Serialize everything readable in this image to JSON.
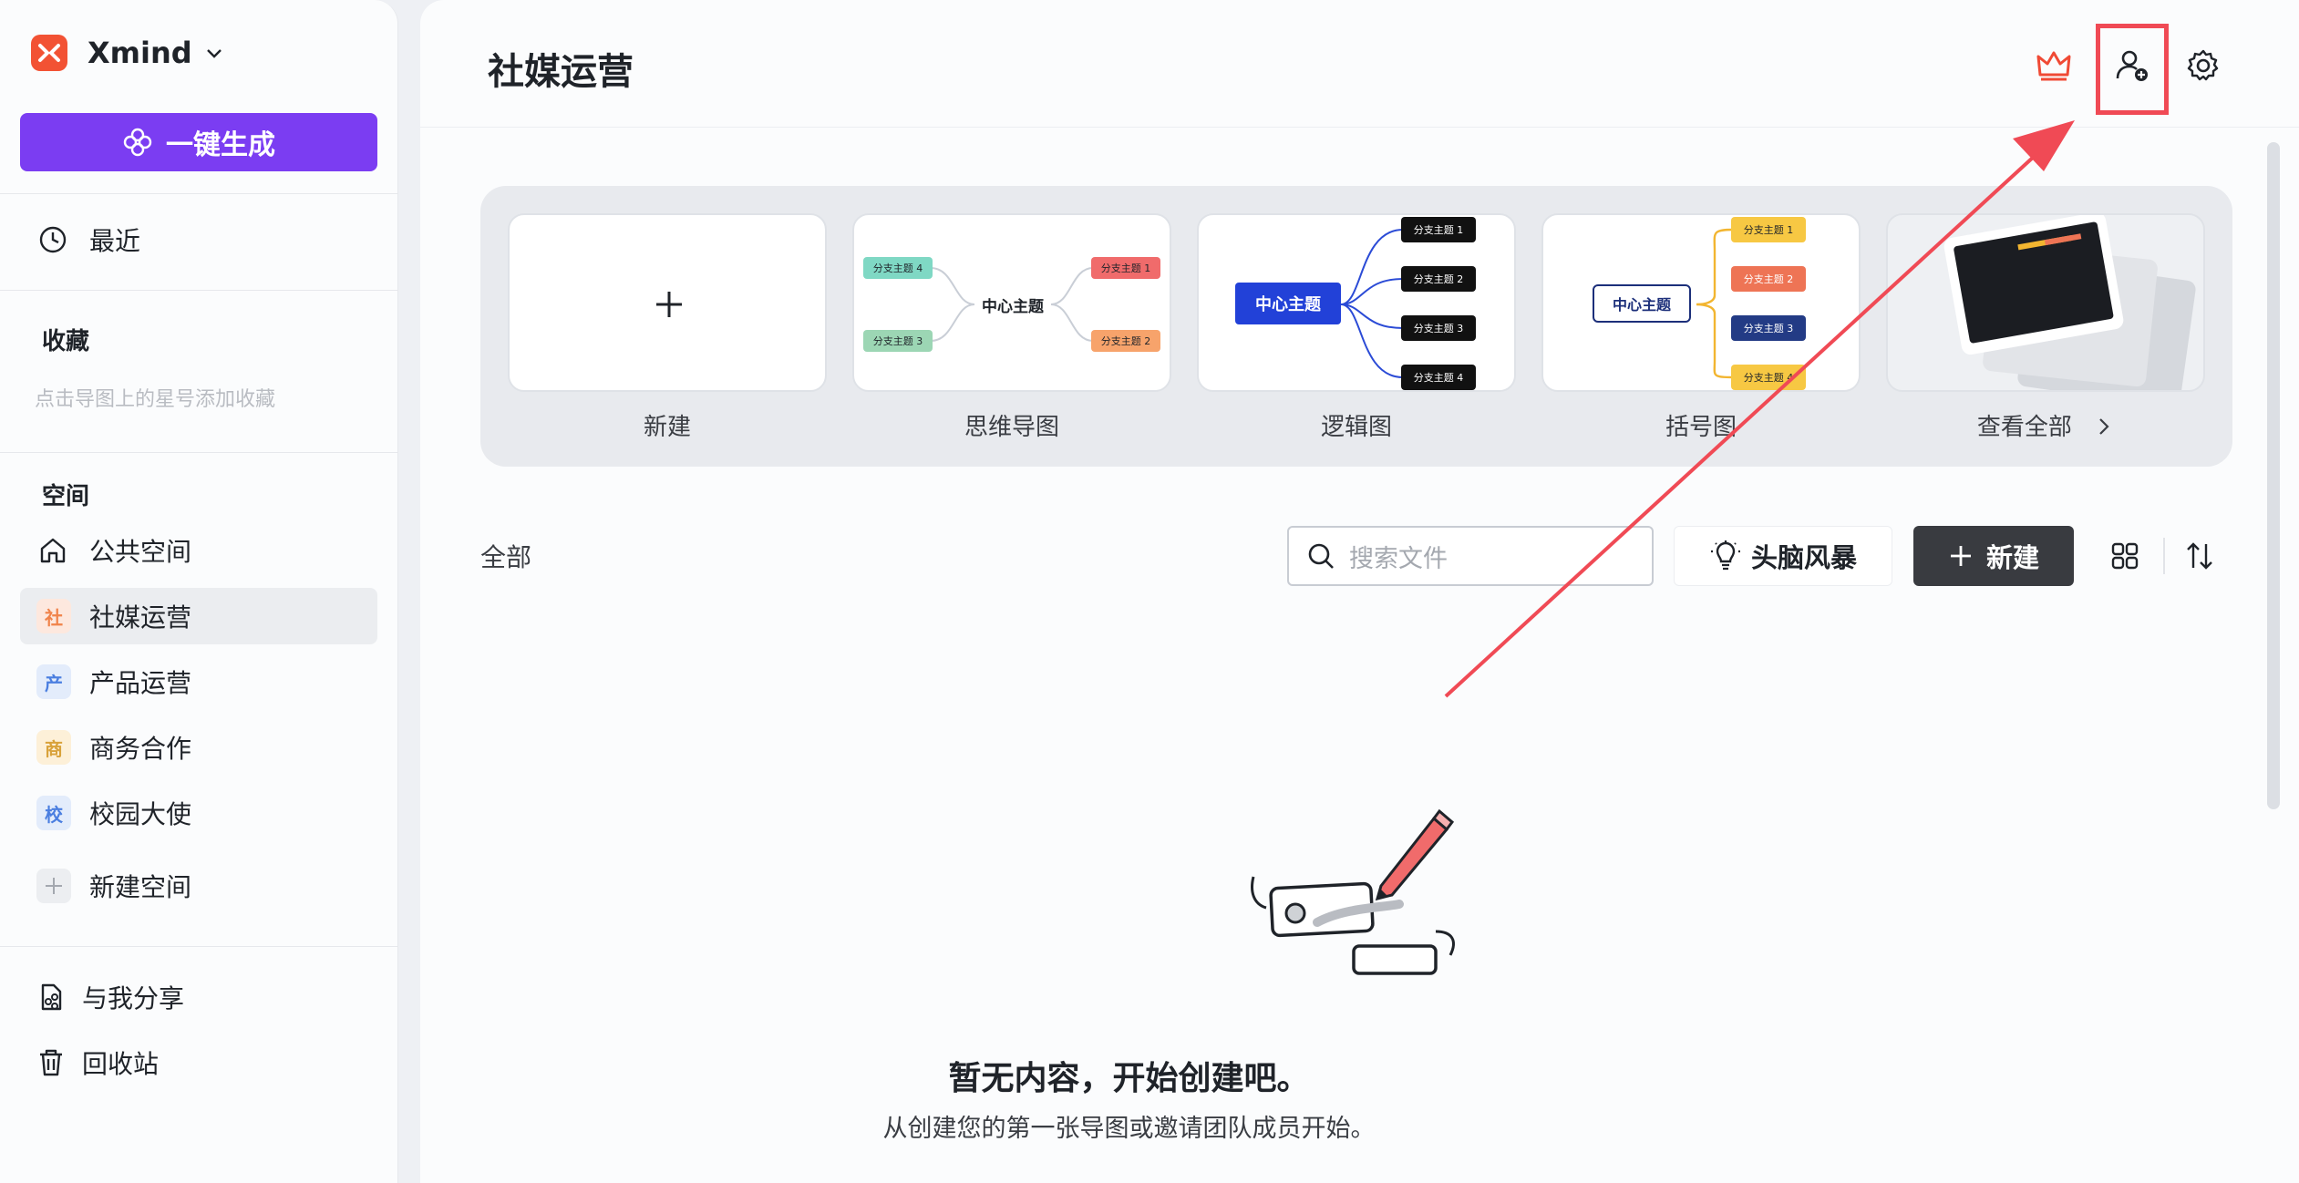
{
  "app": {
    "name": "Xmind"
  },
  "sidebar": {
    "ai_button": "一键生成",
    "recent": "最近",
    "favorites_title": "收藏",
    "favorites_hint": "点击导图上的星号添加收藏",
    "spaces_title": "空间",
    "public_space": "公共空间",
    "spaces": [
      {
        "badge": "社",
        "label": "社媒运营",
        "badge_bg": "#fde8de",
        "badge_fg": "#f0834a"
      },
      {
        "badge": "产",
        "label": "产品运营",
        "badge_bg": "#e3ecfb",
        "badge_fg": "#4a7ee0"
      },
      {
        "badge": "商",
        "label": "商务合作",
        "badge_bg": "#fdf0d8",
        "badge_fg": "#d9a23a"
      },
      {
        "badge": "校",
        "label": "校园大使",
        "badge_bg": "#e3ecfb",
        "badge_fg": "#4a7ee0"
      }
    ],
    "new_space": "新建空间",
    "shared": "与我分享",
    "trash": "回收站"
  },
  "header": {
    "title": "社媒运营"
  },
  "templates": {
    "items": [
      {
        "label": "新建"
      },
      {
        "label": "思维导图",
        "center": "中心主题",
        "branches": [
          "分支主题 4",
          "分支主题 3",
          "分支主题 1",
          "分支主题 2"
        ]
      },
      {
        "label": "逻辑图",
        "center": "中心主题",
        "branches": [
          "分支主题 1",
          "分支主题 2",
          "分支主题 3",
          "分支主题 4"
        ]
      },
      {
        "label": "括号图",
        "center": "中心主题",
        "branches": [
          "分支主题 1",
          "分支主题 2",
          "分支主题 3",
          "分支主题 4"
        ]
      },
      {
        "label": "查看全部"
      }
    ]
  },
  "files": {
    "section_label": "全部",
    "search_placeholder": "搜索文件",
    "brainstorm": "头脑风暴",
    "new_button": "新建"
  },
  "empty": {
    "title": "暂无内容，开始创建吧。",
    "subtitle": "从创建您的第一张导图或邀请团队成员开始。"
  },
  "colors": {
    "accent": "#7b3df2",
    "highlight": "#f04a55",
    "brand": "#f25234"
  }
}
